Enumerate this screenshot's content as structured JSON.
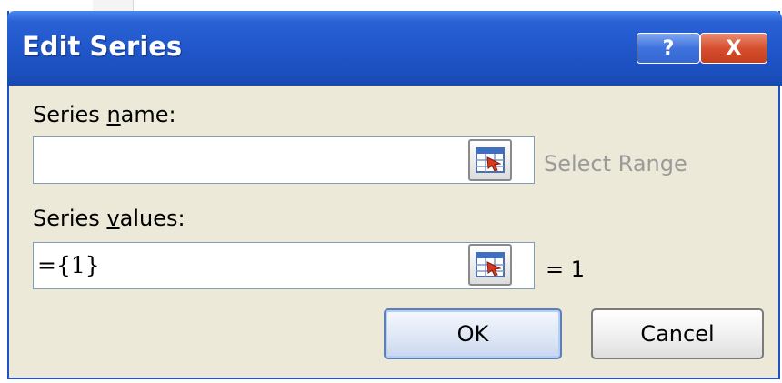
{
  "window": {
    "title": "Edit Series",
    "help_label": "?",
    "close_label": "X",
    "colors": {
      "titlebar": "#1f55c8",
      "close": "#d6502f",
      "body": "#ece9d8"
    }
  },
  "series_name": {
    "label_pre": "Series ",
    "label_accel": "n",
    "label_post": "ame:",
    "value": "",
    "hint": "Select Range",
    "picker_icon": "range-selector-icon"
  },
  "series_values": {
    "label_pre": "Series ",
    "label_accel": "v",
    "label_post": "alues:",
    "value": "={1}",
    "hint": "= 1",
    "picker_icon": "range-selector-icon"
  },
  "buttons": {
    "ok": "OK",
    "cancel": "Cancel"
  }
}
